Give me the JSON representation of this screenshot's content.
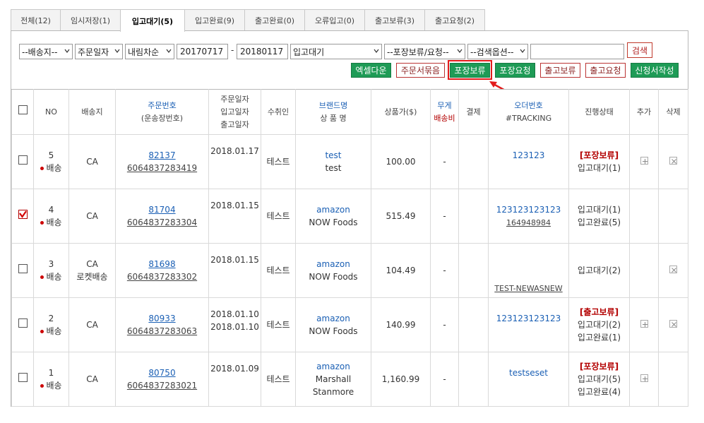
{
  "tabs": [
    {
      "label": "전체(12)",
      "active": false
    },
    {
      "label": "임시저장(1)",
      "active": false
    },
    {
      "label": "입고대기(5)",
      "active": true
    },
    {
      "label": "입고완료(9)",
      "active": false
    },
    {
      "label": "출고완료(0)",
      "active": false
    },
    {
      "label": "오류입고(0)",
      "active": false
    },
    {
      "label": "출고보류(3)",
      "active": false
    },
    {
      "label": "출고요청(2)",
      "active": false
    }
  ],
  "search": {
    "dest": "--배송지--",
    "date_type": "주문일자",
    "sort": "내림차순",
    "date_from": "20170717",
    "date_sep": "-",
    "date_to": "20180117",
    "status": "입고대기",
    "hold": "--포장보류/요청--",
    "option": "--검색옵션--",
    "keyword": "",
    "search_button": "검색"
  },
  "actions": {
    "excel": "엑셀다운",
    "merge": "주문서묶음",
    "pack_hold": "포장보류",
    "pack_request": "포장요청",
    "ship_hold": "출고보류",
    "ship_request": "출고요청",
    "form_write": "신청서작성"
  },
  "headers": {
    "no": "NO",
    "dest": "배송지",
    "order_no": "주문번호",
    "waybill": "(운송장번호)",
    "date1": "주문일자",
    "date2": "입고일자",
    "date3": "출고일자",
    "receiver": "수취인",
    "brand": "브랜드명",
    "product": "상 품 명",
    "price": "상품가($)",
    "weight": "무게",
    "ship_fee": "배송비",
    "payment": "결제",
    "order_id": "오더번호",
    "tracking": "#TRACKING",
    "progress": "진행상태",
    "add": "추가",
    "delete": "삭제"
  },
  "rows": [
    {
      "no": "5",
      "type": "배송",
      "dest": "CA",
      "dest2": "",
      "order": "82137",
      "waybill": "6064837283419",
      "dates": [
        "2018.01.17"
      ],
      "receiver": "테스트",
      "brand": "test",
      "product": "test",
      "price": "100.00",
      "weight": "-",
      "order_id": "123123",
      "tracking": "",
      "tag": "[포장보류]",
      "status": [
        "입고대기(1)"
      ],
      "checked": false,
      "add": true,
      "del": true
    },
    {
      "no": "4",
      "type": "배송",
      "dest": "CA",
      "dest2": "",
      "order": "81704",
      "waybill": "6064837283304",
      "dates": [
        "2018.01.15"
      ],
      "receiver": "테스트",
      "brand": "amazon",
      "product": "NOW Foods",
      "price": "515.49",
      "weight": "-",
      "order_id": "123123123123",
      "tracking": "164948984",
      "tag": "",
      "status": [
        "입고대기(1)",
        "입고완료(5)"
      ],
      "checked": true,
      "add": false,
      "del": false
    },
    {
      "no": "3",
      "type": "배송",
      "dest": "CA",
      "dest2": "로켓배송",
      "order": "81698",
      "waybill": "6064837283302",
      "dates": [
        "2018.01.15"
      ],
      "receiver": "테스트",
      "brand": "amazon",
      "product": "NOW Foods",
      "price": "104.49",
      "weight": "-",
      "order_id": "",
      "tracking": "TEST-NEWASNEW",
      "tag": "",
      "status": [
        "입고대기(2)"
      ],
      "checked": false,
      "add": false,
      "del": true
    },
    {
      "no": "2",
      "type": "배송",
      "dest": "CA",
      "dest2": "",
      "order": "80933",
      "waybill": "6064837283063",
      "dates": [
        "2018.01.10",
        "2018.01.10"
      ],
      "receiver": "테스트",
      "brand": "amazon",
      "product": "NOW Foods",
      "price": "140.99",
      "weight": "-",
      "order_id": "123123123123",
      "tracking": "",
      "tag": "[출고보류]",
      "status": [
        "입고대기(2)",
        "입고완료(1)"
      ],
      "checked": false,
      "add": true,
      "del": true
    },
    {
      "no": "1",
      "type": "배송",
      "dest": "CA",
      "dest2": "",
      "order": "80750",
      "waybill": "6064837283021",
      "dates": [
        "2018.01.09"
      ],
      "receiver": "테스트",
      "brand": "amazon",
      "product": "Marshall Stanmore",
      "price": "1,160.99",
      "weight": "-",
      "order_id": "testseset",
      "tracking": "",
      "tag": "[포장보류]",
      "status": [
        "입고대기(5)",
        "입고완료(4)"
      ],
      "checked": false,
      "add": true,
      "del": false
    }
  ]
}
